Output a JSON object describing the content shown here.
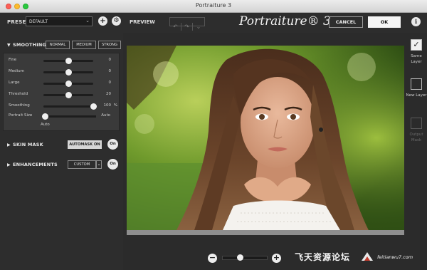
{
  "window": {
    "title": "Portraiture 3"
  },
  "toolbar": {
    "preset_label": "PRESET",
    "preset_value": "DEFAULT",
    "preview_label": "PREVIEW",
    "brand": "Portraiture® 3",
    "cancel_label": "CANCEL",
    "ok_label": "OK",
    "info_icon": "i"
  },
  "smoothing": {
    "title": "SMOOTHING",
    "modes": [
      "NORMAL",
      "MEDIUM",
      "STRONG"
    ],
    "sliders": [
      {
        "label": "Fine",
        "value": "0",
        "unit": "",
        "fraction": 0.5
      },
      {
        "label": "Medium",
        "value": "0",
        "unit": "",
        "fraction": 0.5
      },
      {
        "label": "Large",
        "value": "0",
        "unit": "",
        "fraction": 0.5
      },
      {
        "label": "Threshold",
        "value": "20",
        "unit": "",
        "fraction": 0.5
      },
      {
        "label": "Smoothing",
        "value": "100",
        "unit": "%",
        "fraction": 1.0
      }
    ],
    "portrait_size": {
      "label": "Portrait Size",
      "left_value": "Auto",
      "right_value": "Auto",
      "fraction": 0.0
    }
  },
  "skin_mask": {
    "title": "SKIN MASK",
    "button": "AUTOMASK ON",
    "toggle": "On"
  },
  "enhancements": {
    "title": "ENHANCEMENTS",
    "button": "CUSTOM",
    "toggle": "On"
  },
  "layers": {
    "same_layer": "Same Layer",
    "new_layer": "New Layer",
    "output_mask": "Output Mask",
    "same_layer_checked": true
  },
  "zoom": {
    "fraction": 0.38
  },
  "watermark": {
    "text": "飞天资源论坛",
    "url": "feitianwu7.com"
  },
  "colors": {
    "panel": "#2d2d2d",
    "preview_bg": "#8e8e8e",
    "ok_bg": "#f5f5f5"
  }
}
